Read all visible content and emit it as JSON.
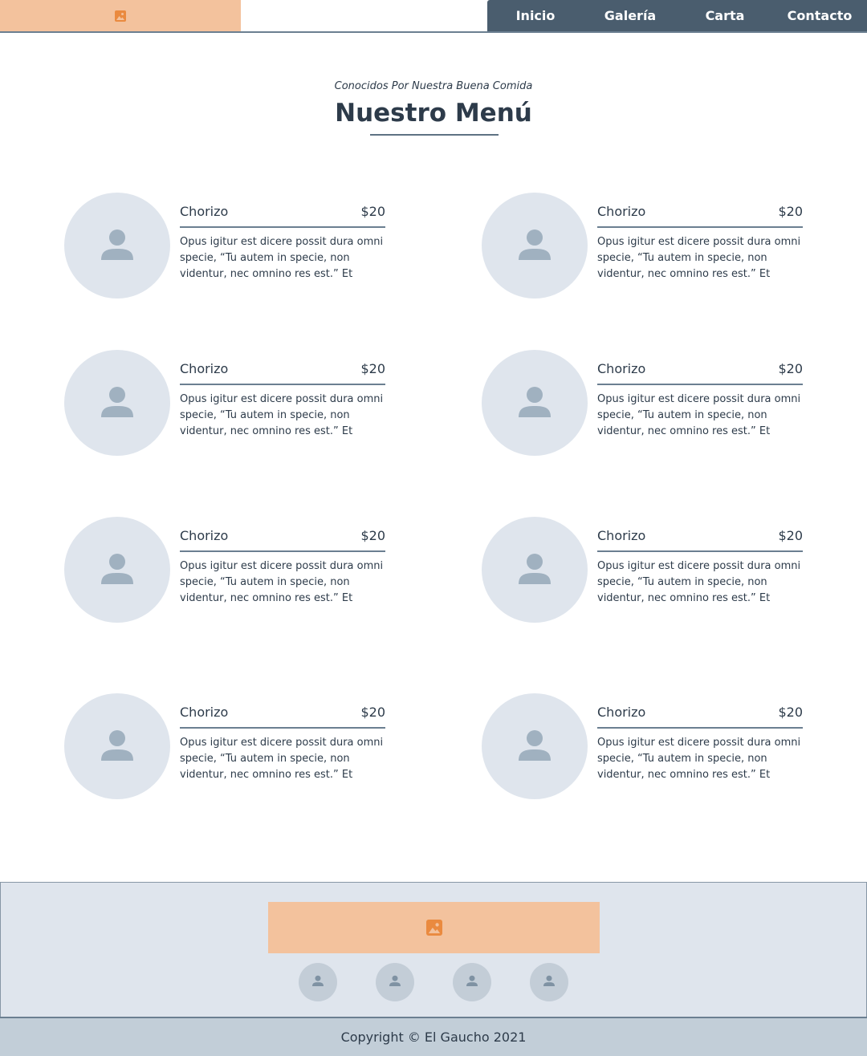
{
  "header": {
    "logo_icon": "image-icon",
    "nav": [
      "Inicio",
      "Galería",
      "Carta",
      "Contacto"
    ]
  },
  "section": {
    "subtitle": "Conocidos Por Nuestra Buena Comida",
    "title": "Nuestro Menú"
  },
  "menu": {
    "items": [
      {
        "name": "Chorizo",
        "price": "$20",
        "description": "Opus igitur est dicere possit dura omni specie, “Tu autem in specie, non videntur, nec omnino res est.” Et",
        "icon": "person-icon"
      },
      {
        "name": "Chorizo",
        "price": "$20",
        "description": "Opus igitur est dicere possit dura omni specie, “Tu autem in specie, non videntur, nec omnino res est.” Et",
        "icon": "person-icon"
      },
      {
        "name": "Chorizo",
        "price": "$20",
        "description": "Opus igitur est dicere possit dura omni specie, “Tu autem in specie, non videntur, nec omnino res est.” Et",
        "icon": "person-icon"
      },
      {
        "name": "Chorizo",
        "price": "$20",
        "description": "Opus igitur est dicere possit dura omni specie, “Tu autem in specie, non videntur, nec omnino res est.” Et",
        "icon": "person-icon"
      },
      {
        "name": "Chorizo",
        "price": "$20",
        "description": "Opus igitur est dicere possit dura omni specie, “Tu autem in specie, non videntur, nec omnino res est.” Et",
        "icon": "person-icon"
      },
      {
        "name": "Chorizo",
        "price": "$20",
        "description": "Opus igitur est dicere possit dura omni specie, “Tu autem in specie, non videntur, nec omnino res est.” Et",
        "icon": "person-icon"
      },
      {
        "name": "Chorizo",
        "price": "$20",
        "description": "Opus igitur est dicere possit dura omni specie, “Tu autem in specie, non videntur, nec omnino res est.” Et",
        "icon": "person-icon"
      },
      {
        "name": "Chorizo",
        "price": "$20",
        "description": "Opus igitur est dicere possit dura omni specie, “Tu autem in specie, non videntur, nec omnino res est.” Et",
        "icon": "person-icon"
      }
    ]
  },
  "footer": {
    "logo_icon": "image-icon",
    "social_icons": [
      "person-icon",
      "person-icon",
      "person-icon",
      "person-icon"
    ],
    "copyright": "Copyright © El Gaucho 2021"
  },
  "colors": {
    "accent": "#f3c29d",
    "icon_accent": "#ea8a3f",
    "nav_bg": "#4a5d6e",
    "placeholder": "#dfe5ed",
    "text": "#2d3b4a"
  }
}
